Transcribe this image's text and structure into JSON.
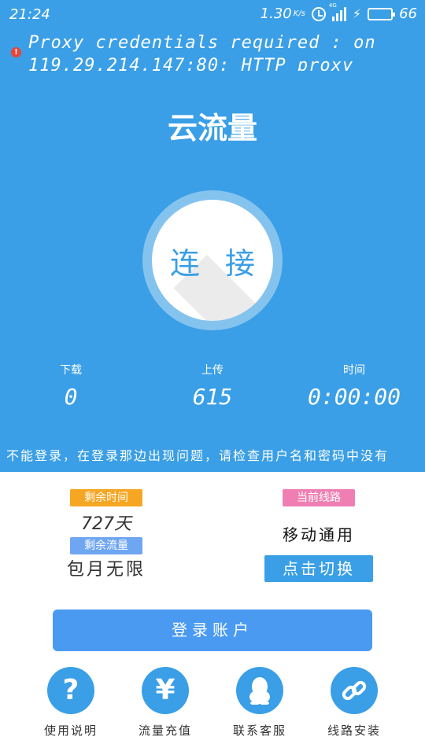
{
  "status_bar": {
    "time": "21:24",
    "speed": "1.30",
    "speed_unit": "K/s",
    "network_label": "4G",
    "battery": "66",
    "icons": [
      "alarm-icon",
      "signal-icon",
      "charging-icon",
      "battery-icon"
    ]
  },
  "error": {
    "text": "Proxy credentials required : on 119.29.214.147:80: HTTP proxy"
  },
  "app_title": "云流量",
  "connect_label": "连 接",
  "stats": {
    "download_label": "下载",
    "download_value": "0",
    "upload_label": "上传",
    "upload_value": "615",
    "time_label": "时间",
    "time_value": "0:00:00"
  },
  "notice": "不能登录，在登录那边出现问题，请检查用户名和密码中没有",
  "account": {
    "time_left_label": "剩余时间",
    "time_left_value": "727天",
    "flow_left_label": "剩余流量",
    "flow_left_value": "包月无限",
    "line_label": "当前线路",
    "line_value": "移动通用",
    "switch_button": "点击切换"
  },
  "login_button": "登录账户",
  "menu": [
    {
      "icon": "help-icon",
      "glyph": "?",
      "label": "使用说明"
    },
    {
      "icon": "yuan-icon",
      "glyph": "¥",
      "label": "流量充值"
    },
    {
      "icon": "qq-penguin-icon",
      "glyph": "",
      "label": "联系客服"
    },
    {
      "icon": "link-icon",
      "glyph": "",
      "label": "线路安装"
    }
  ],
  "colors": {
    "primary": "#3a9fe6",
    "login_button": "#4a9af2",
    "badge_time": "#f5a623",
    "badge_flow": "#6fa6f2",
    "badge_line": "#ef7fb3",
    "error_dot": "#e8443a"
  }
}
